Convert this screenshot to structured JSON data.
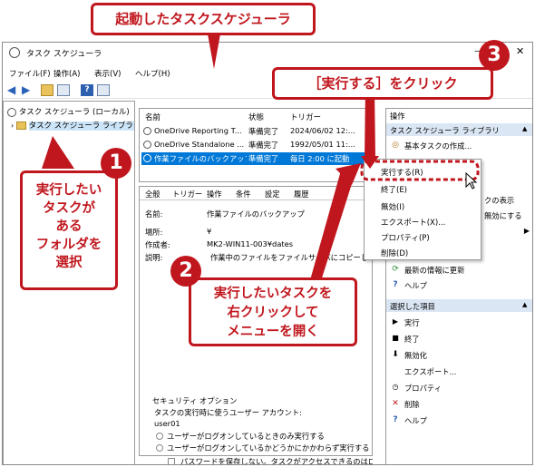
{
  "window": {
    "title": "タスク スケジューラ",
    "minimize": "—",
    "close": "✕"
  },
  "menu": [
    "ファイル(F)",
    "操作(A)",
    "表示(V)",
    "ヘルプ(H)"
  ],
  "tree": {
    "root": "タスク スケジューラ (ローカル)",
    "library": "タスク スケジューラ ライブラリ"
  },
  "task_table": {
    "headers": [
      "名前",
      "状態",
      "トリガー",
      "次"
    ],
    "rows": [
      {
        "name": "OneDrive Reporting T...",
        "state": "準備完了",
        "trigger": "2024/06/02 12:..."
      },
      {
        "name": "OneDrive Standalone ...",
        "state": "準備完了",
        "trigger": "1992/05/01 11:..."
      },
      {
        "name": "作業ファイルのバックアップ",
        "state": "準備完了",
        "trigger": "毎日 2:00 に起動"
      }
    ]
  },
  "detail": {
    "tabs": [
      "全般",
      "トリガー",
      "操作",
      "条件",
      "設定",
      "履歴"
    ],
    "name_label": "名前:",
    "name_value": "作業ファイルのバックアップ",
    "location_label": "場所:",
    "location_value": "¥",
    "author_label": "作成者:",
    "author_value": "MK2-WIN11-003¥dates",
    "desc_label": "説明:",
    "desc_value": "作業中のファイルをファイルサーバにコピーして",
    "security_title": "セキュリティ オプション",
    "account_label": "タスクの実行時に使うユーザー アカウント:",
    "account_value": "user01",
    "radio1": "ユーザーがログオンしているときのみ実行する",
    "radio2": "ユーザーがログオンしているかどうかにかかわらず実行する",
    "checkbox": "パスワードを保存しない。タスクがアクセスできるのはローカ"
  },
  "actions": {
    "header": "操作",
    "section1": "タスク スケジューラ ライブラリ",
    "items1": [
      "基本タスクの作成...",
      "クの表示",
      "無効にする",
      "最新の情報に更新",
      "ヘルプ"
    ],
    "section2": "選択した項目",
    "items2": [
      "実行",
      "終了",
      "無効化",
      "エクスポート...",
      "プロパティ",
      "削除",
      "ヘルプ"
    ]
  },
  "context_menu": [
    "実行する(R)",
    "終了(E)",
    "無効(I)",
    "エクスポート(X)...",
    "プロパティ(P)",
    "削除(D)"
  ],
  "callouts": {
    "title": "起動したタスクスケジューラ",
    "step1": "実行したいタスクがあるフォルダを選択",
    "step1_lines": [
      "実行したい",
      "タスクが",
      "ある",
      "フォルダを",
      "選択"
    ],
    "step2_lines": [
      "実行したいタスクを",
      "右クリックして",
      "メニューを開く"
    ],
    "step3": "［実行する］をクリック",
    "num1": "1",
    "num2": "2",
    "num3": "3"
  },
  "colors": {
    "accent_red": "#c0161d",
    "selection_blue": "#0078d7",
    "section_header": "#dbe6f4"
  }
}
